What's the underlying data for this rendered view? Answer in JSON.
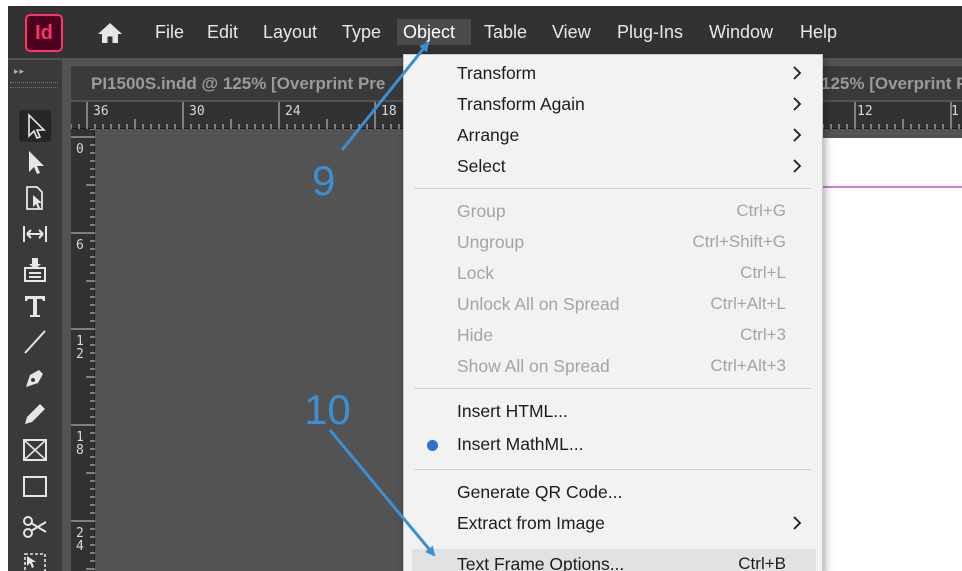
{
  "app": {
    "logo_text": "Id",
    "menu": [
      "File",
      "Edit",
      "Layout",
      "Type",
      "Object",
      "Table",
      "View",
      "Plug-Ins",
      "Window",
      "Help"
    ],
    "active_menu": "Object"
  },
  "document": {
    "tab_title": "PI1500S.indd @ 125% [Overprint Pre",
    "tab_title_2": "125% [Overprint P"
  },
  "rulers": {
    "horizontal": [
      "36",
      "30",
      "24",
      "18",
      "12",
      "1"
    ],
    "vertical": [
      "0",
      "6",
      "12",
      "18",
      "24"
    ]
  },
  "object_menu": {
    "group1": [
      {
        "label": "Transform",
        "submenu": true
      },
      {
        "label": "Transform Again",
        "submenu": true
      },
      {
        "label": "Arrange",
        "submenu": true
      },
      {
        "label": "Select",
        "submenu": true
      }
    ],
    "group2": [
      {
        "label": "Group",
        "shortcut": "Ctrl+G",
        "disabled": true
      },
      {
        "label": "Ungroup",
        "shortcut": "Ctrl+Shift+G",
        "disabled": true
      },
      {
        "label": "Lock",
        "shortcut": "Ctrl+L",
        "disabled": true
      },
      {
        "label": "Unlock All on Spread",
        "shortcut": "Ctrl+Alt+L",
        "disabled": true
      },
      {
        "label": "Hide",
        "shortcut": "Ctrl+3",
        "disabled": true
      },
      {
        "label": "Show All on Spread",
        "shortcut": "Ctrl+Alt+3",
        "disabled": true
      }
    ],
    "group3": [
      {
        "label": "Insert HTML..."
      },
      {
        "label": "Insert MathML...",
        "dot": true
      }
    ],
    "group4": [
      {
        "label": "Generate QR Code..."
      },
      {
        "label": "Extract from Image",
        "submenu": true
      },
      {
        "label": "Text Frame Options...",
        "shortcut": "Ctrl+B",
        "highlighted": true
      }
    ]
  },
  "annotations": {
    "step_9": "9",
    "step_10": "10",
    "color": "#3d8fd1"
  },
  "colors": {
    "menubar": "#323232",
    "workspace": "#535353",
    "logo": "#ff3366",
    "menu_bg": "#f2f2f2"
  }
}
